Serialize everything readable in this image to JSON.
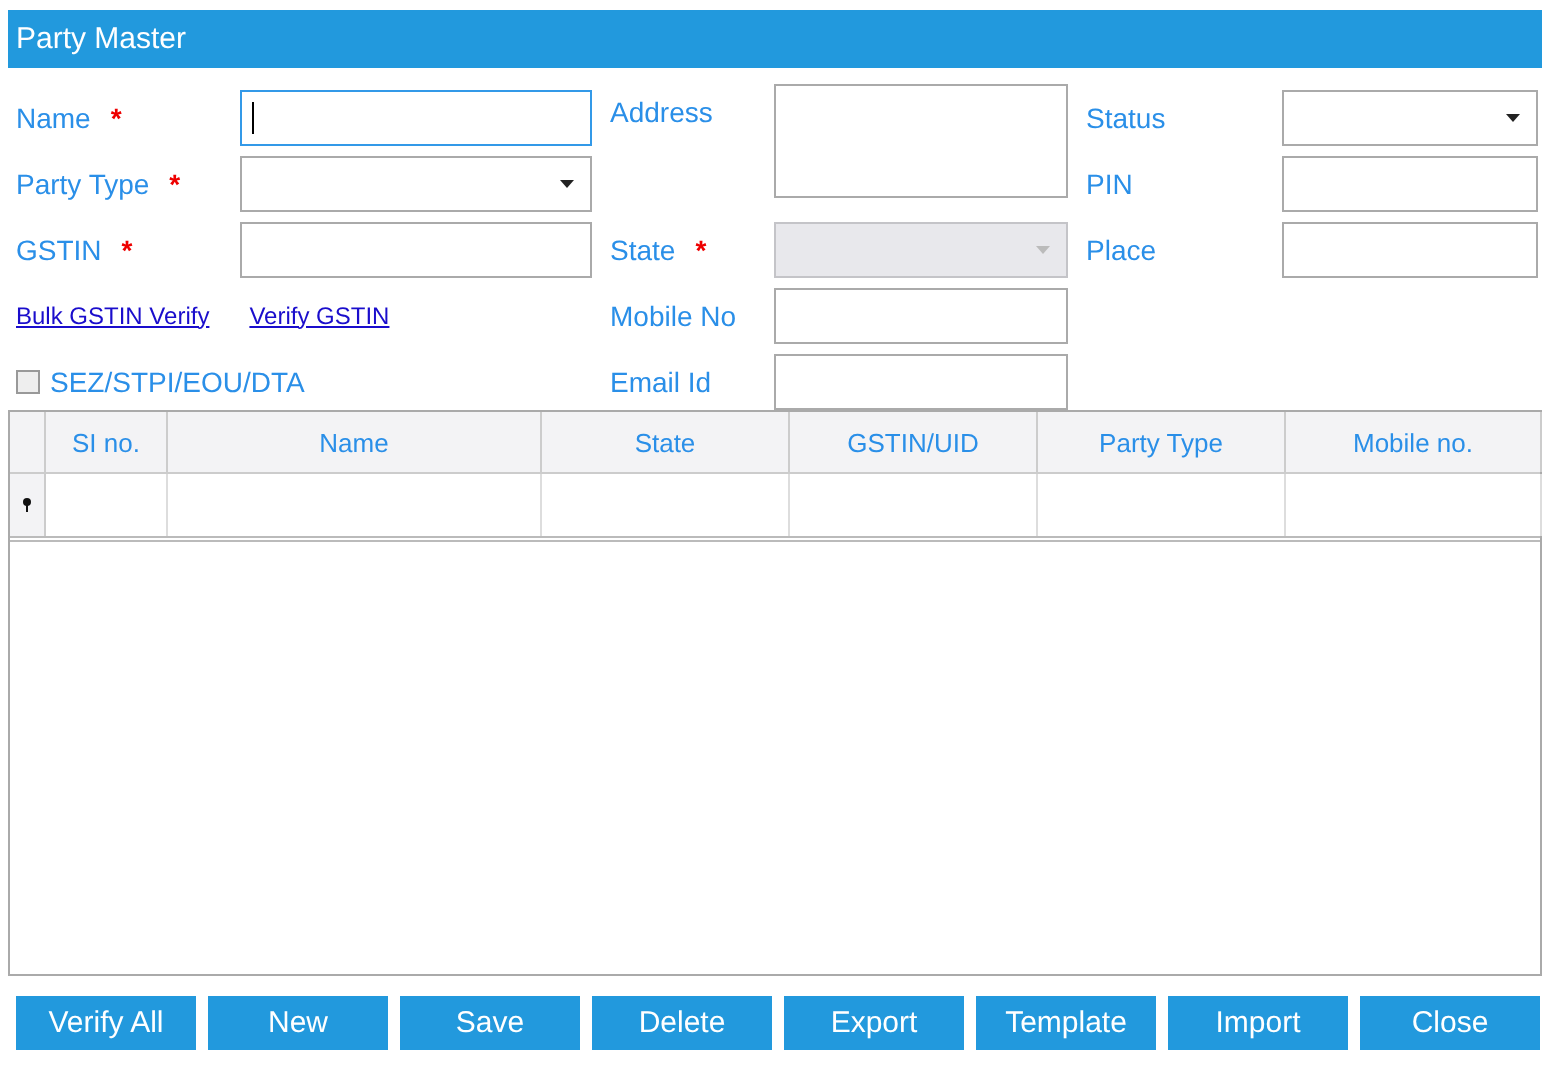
{
  "window": {
    "title": "Party Master"
  },
  "form": {
    "columns": [
      [
        {
          "kind": "text",
          "label": "Name",
          "required_mark": "*",
          "focused": true,
          "disabled": false
        },
        {
          "kind": "select",
          "label": "Party Type",
          "required_mark": "*",
          "focused": false,
          "disabled": false
        },
        {
          "kind": "text",
          "label": "GSTIN",
          "required_mark": "*",
          "focused": false,
          "disabled": false
        },
        {
          "kind": "links",
          "links": [
            "Bulk GSTIN Verify",
            "Verify GSTIN"
          ]
        },
        {
          "kind": "checkbox",
          "label": "SEZ/STPI/EOU/DTA",
          "checked": false
        }
      ],
      [
        {
          "kind": "textarea",
          "label": "Address",
          "focused": false,
          "disabled": false
        },
        {
          "kind": "select",
          "label": "State",
          "required_mark": "*",
          "focused": false,
          "disabled": true
        },
        {
          "kind": "text",
          "label": "Mobile No",
          "focused": false,
          "disabled": false
        },
        {
          "kind": "text",
          "label": "Email Id",
          "focused": false,
          "disabled": false
        }
      ],
      [
        {
          "kind": "select",
          "label": "Status",
          "focused": false,
          "disabled": false
        },
        {
          "kind": "text",
          "label": "PIN",
          "focused": false,
          "disabled": false
        },
        {
          "kind": "text",
          "label": "Place",
          "focused": false,
          "disabled": false
        }
      ]
    ]
  },
  "table": {
    "columns": [
      "SI no.",
      "Name",
      "State",
      "GSTIN/UID",
      "Party Type",
      "Mobile no."
    ]
  },
  "buttons": [
    "Verify All",
    "New",
    "Save",
    "Delete",
    "Export",
    "Template",
    "Import",
    "Close"
  ]
}
